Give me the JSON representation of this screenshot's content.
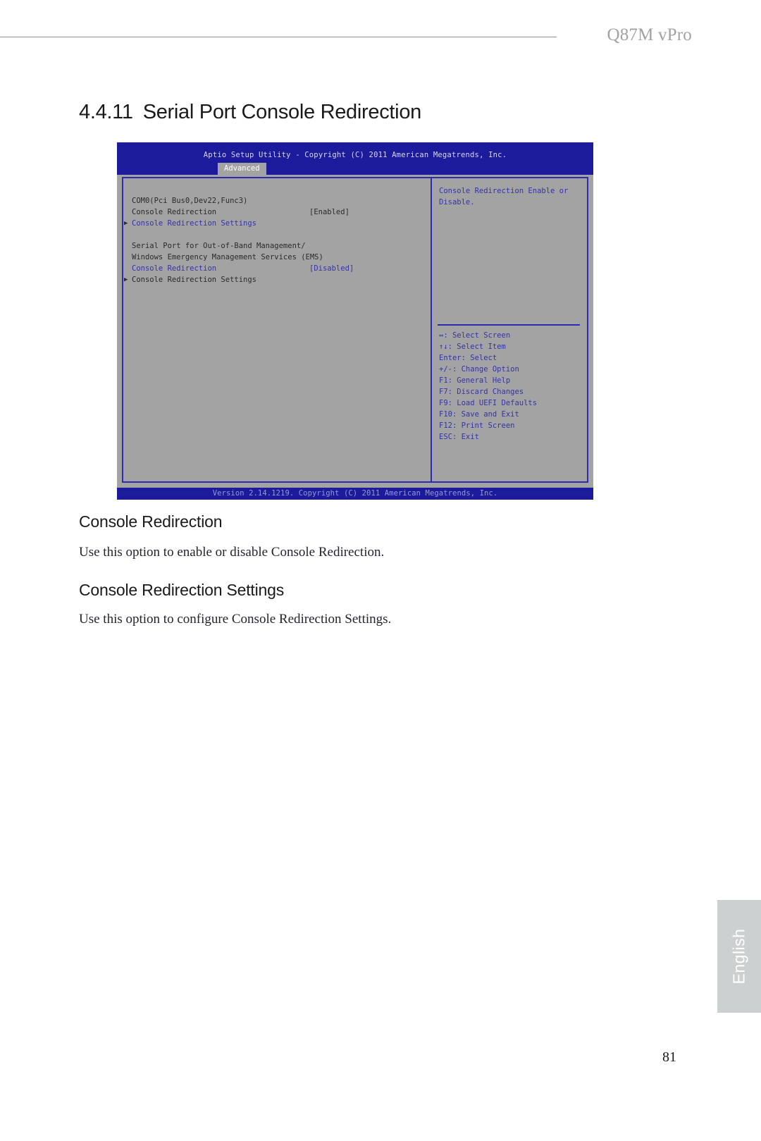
{
  "header": {
    "title": "Q87M vPro"
  },
  "section": {
    "number": "4.4.11",
    "title": "Serial Port Console Redirection"
  },
  "bios": {
    "title_bar": "Aptio Setup Utility - Copyright (C) 2011 American Megatrends, Inc.",
    "active_tab": "Advanced",
    "menu": [
      {
        "arrow": "",
        "label": "COM0(Pci Bus0,Dev22,Func3)",
        "value": "",
        "color": "dark"
      },
      {
        "arrow": "",
        "label": "Console Redirection",
        "value": "[Enabled]",
        "color": "dark"
      },
      {
        "arrow": "▶",
        "label": "Console Redirection Settings",
        "value": "",
        "color": "blue"
      },
      {
        "arrow": "",
        "label": "",
        "value": "",
        "color": "dark"
      },
      {
        "arrow": "",
        "label": "Serial Port for Out-of-Band Management/",
        "value": "",
        "color": "dark"
      },
      {
        "arrow": "",
        "label": "Windows Emergency Management Services (EMS)",
        "value": "",
        "color": "dark"
      },
      {
        "arrow": "",
        "label": "Console Redirection",
        "value": "[Disabled]",
        "color": "blue"
      },
      {
        "arrow": "▶",
        "label": "Console Redirection Settings",
        "value": "",
        "color": "dark"
      }
    ],
    "help_text_lines": [
      "Console Redirection Enable or",
      "Disable."
    ],
    "key_bindings": [
      "↔: Select Screen",
      "↑↓: Select Item",
      "Enter: Select",
      "+/-: Change Option",
      "F1: General Help",
      "F7: Discard Changes",
      "F9: Load UEFI Defaults",
      "F10: Save and Exit",
      "F12: Print Screen",
      "ESC: Exit"
    ],
    "version_bar": "Version 2.14.1219. Copyright (C) 2011 American Megatrends, Inc."
  },
  "content": {
    "console_redirection_heading": "Console Redirection",
    "console_redirection_body": "Use this option to enable or disable Console Redirection.",
    "console_redirection_settings_heading": "Console Redirection Settings",
    "console_redirection_settings_body": "Use this option to configure Console Redirection Settings."
  },
  "footer": {
    "language_tab": "English",
    "page_number": "81"
  },
  "colors": {
    "bios_blue": "#1b1b9b",
    "bios_gray": "#a3a3a3",
    "bios_text_blue": "#3333aa",
    "lang_tab_bg": "#cdd0d0",
    "header_gray": "#a3a3a3"
  }
}
